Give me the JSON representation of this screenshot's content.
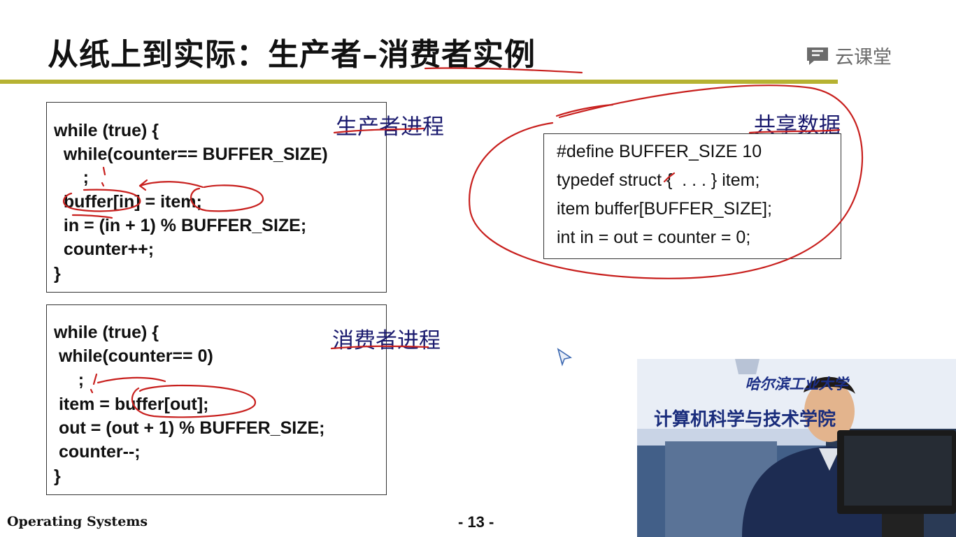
{
  "slide": {
    "title": "从纸上到实际：生产者–消费者实例",
    "brand": "云课堂",
    "footer_left": "Operating Systems",
    "page_number": "- 13 -"
  },
  "producer": {
    "label": "生产者进程",
    "lines": [
      "while (true) {",
      "  while(counter== BUFFER_SIZE)",
      "      ;",
      "  buffer[in] = item;",
      "  in = (in + 1) % BUFFER_SIZE;",
      "  counter++;",
      "}"
    ]
  },
  "consumer": {
    "label": "消费者进程",
    "lines": [
      "while (true) {",
      " while(counter== 0)",
      "     ;",
      " item = buffer[out];",
      " out = (out + 1) % BUFFER_SIZE;",
      " counter--;",
      "}"
    ]
  },
  "shared": {
    "label": "共享数据",
    "lines": [
      "#define BUFFER_SIZE 10",
      "typedef struct {  . . . } item;",
      "item buffer[BUFFER_SIZE];",
      "int in = out = counter = 0;"
    ]
  },
  "video": {
    "banner_university": "哈尔滨工业大学",
    "banner_department": "计算机科学与技术学院"
  },
  "colors": {
    "title_rule": "#b6b232",
    "ink_annotation": "#c8201e",
    "label_text": "#1a1a6e"
  }
}
